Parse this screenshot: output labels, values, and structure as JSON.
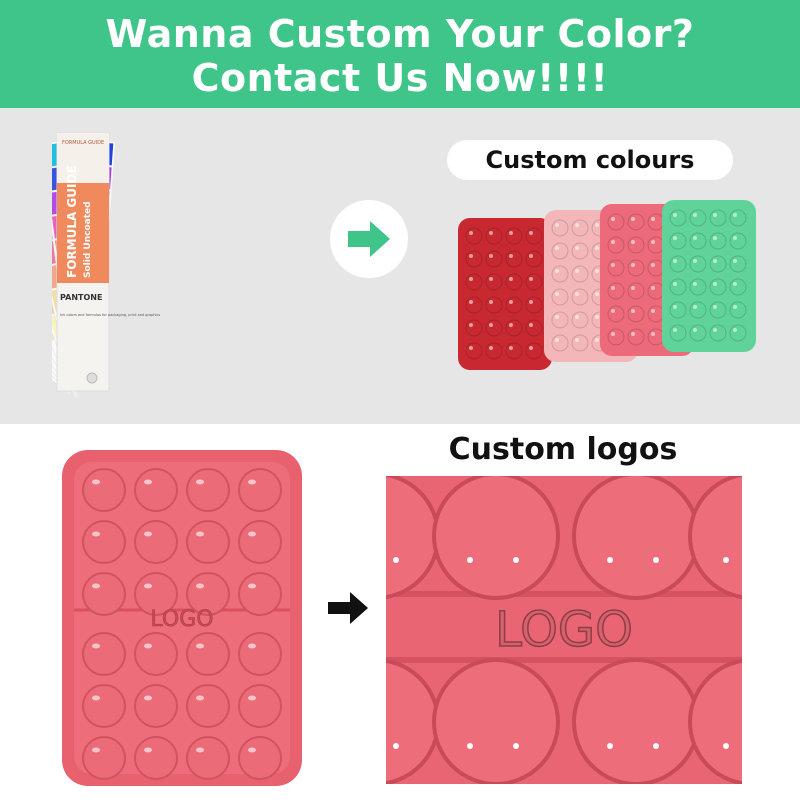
{
  "banner": {
    "line1": "Wanna Custom Your Color?",
    "line2": "Contact Us Now!!!!"
  },
  "custom_colours_label": "Custom colours",
  "custom_logos_label": "Custom logos",
  "guide": {
    "title": "FORMULA GUIDE",
    "subtitle": "Solid Uncoated",
    "brand": "PANTONE",
    "header_small": "FORMULA GUIDE",
    "blurb": "Ink colors and formulas for packaging, print and graphics"
  },
  "logo_text": "LOGO",
  "pad_colors": [
    "#5fd39a",
    "#ec6a7a",
    "#f3b7b9",
    "#c8282f"
  ],
  "accent": "#3fc48a"
}
